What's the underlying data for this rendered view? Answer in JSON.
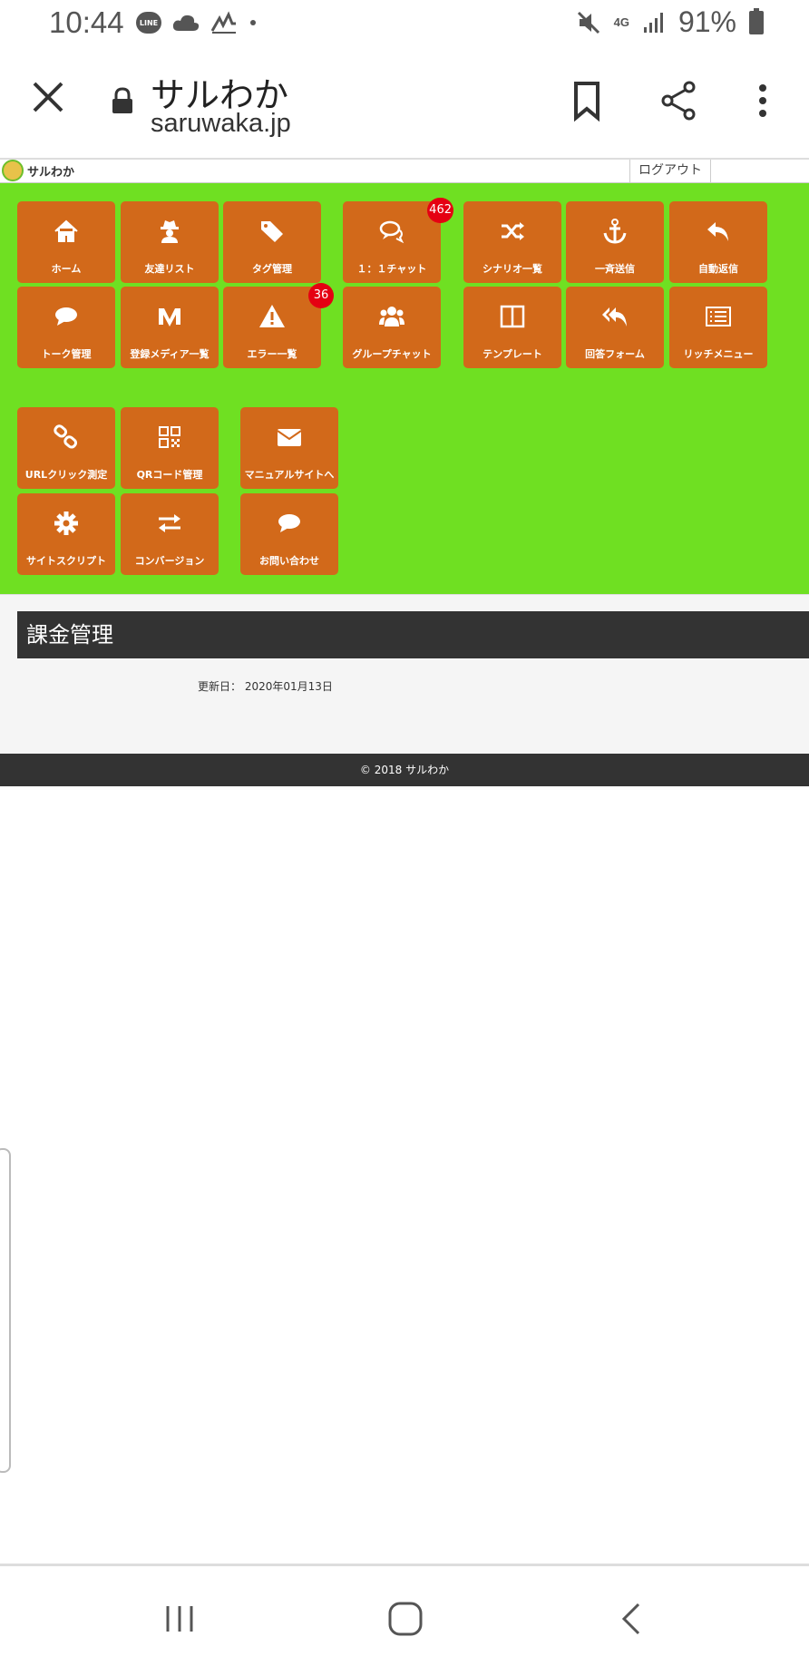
{
  "status_bar": {
    "time": "10:44",
    "line_label": "LINE",
    "network": "4G",
    "battery": "91%",
    "icons": [
      "line-icon",
      "cloud-icon",
      "activity-icon",
      "mute-icon",
      "signal-icon",
      "battery-icon"
    ]
  },
  "browser": {
    "title": "サルわか",
    "url": "saruwaka.jp",
    "icons": [
      "close-icon",
      "lock-icon",
      "bookmark-icon",
      "share-icon",
      "more-icon"
    ]
  },
  "site": {
    "logo_text": "サルわか",
    "logout": "ログアウト"
  },
  "menu": [
    {
      "label": "ホーム",
      "icon": "home-icon"
    },
    {
      "label": "友達リスト",
      "icon": "user-secret-icon"
    },
    {
      "label": "タグ管理",
      "icon": "tags-icon"
    },
    {
      "label": "１：１チャット",
      "icon": "chat-icon",
      "badge": "462"
    },
    {
      "label": "シナリオ一覧",
      "icon": "shuffle-icon"
    },
    {
      "label": "一斉送信",
      "icon": "anchor-icon"
    },
    {
      "label": "自動返信",
      "icon": "reply-icon"
    },
    {
      "label": "トーク管理",
      "icon": "comment-icon"
    },
    {
      "label": "登録メディア一覧",
      "icon": "medium-icon"
    },
    {
      "label": "エラー一覧",
      "icon": "warning-icon",
      "badge": "36"
    },
    {
      "label": "グループチャット",
      "icon": "users-icon"
    },
    {
      "label": "テンプレート",
      "icon": "columns-icon"
    },
    {
      "label": "回答フォーム",
      "icon": "reply-all-icon"
    },
    {
      "label": "リッチメニュー",
      "icon": "list-alt-icon"
    },
    {
      "label": "URLクリック測定",
      "icon": "link-icon"
    },
    {
      "label": "QRコード管理",
      "icon": "qrcode-icon"
    },
    {
      "label": "マニュアルサイトへ",
      "icon": "envelope-icon"
    },
    {
      "label": "サイトスクリプト",
      "icon": "gear-icon"
    },
    {
      "label": "コンバージョン",
      "icon": "exchange-icon"
    },
    {
      "label": "お問い合わせ",
      "icon": "comment-icon"
    }
  ],
  "main": {
    "heading": "課金管理",
    "updated": "更新日： 2020年01月13日"
  },
  "footer": {
    "copyright": "© 2018 サルわか"
  },
  "android_nav": {
    "icons": [
      "recent-apps-icon",
      "home-nav-icon",
      "back-icon"
    ]
  },
  "colors": {
    "green": "#6fe022",
    "tile": "#d2691a",
    "badge": "#e50012",
    "dark": "#333333"
  }
}
